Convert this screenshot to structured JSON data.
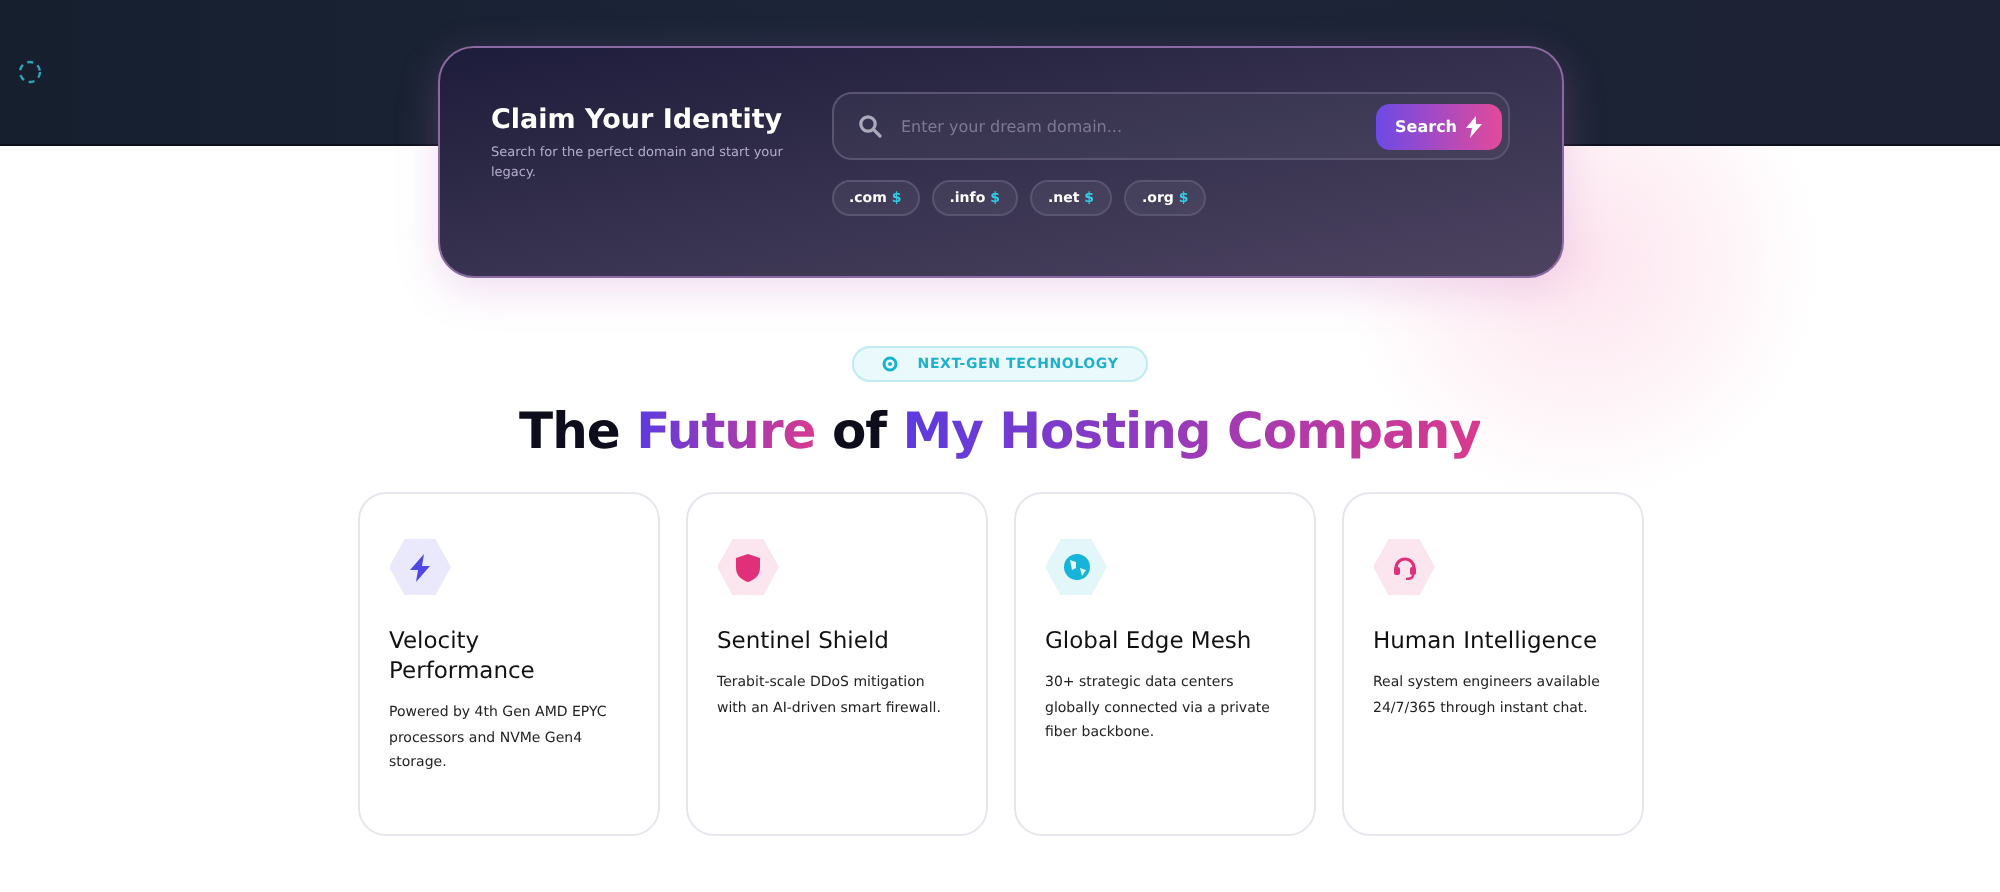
{
  "domain_search": {
    "title": "Claim Your Identity",
    "subtitle": "Search for the perfect domain and start your legacy.",
    "placeholder": "Enter your dream domain...",
    "button": "Search",
    "tlds": [
      {
        "label": ".com",
        "price": "$"
      },
      {
        "label": ".info",
        "price": "$"
      },
      {
        "label": ".net",
        "price": "$"
      },
      {
        "label": ".org",
        "price": "$"
      }
    ]
  },
  "badge": "NEXT-GEN TECHNOLOGY",
  "heading": [
    {
      "text": "The",
      "gradient": false
    },
    {
      "text": "Future",
      "gradient": true
    },
    {
      "text": "of",
      "gradient": false
    },
    {
      "text": "My Hosting Company",
      "gradient": true
    }
  ],
  "features": [
    {
      "kind": "bolt",
      "color": "#4f46e5",
      "title": "Velocity Performance",
      "text": "Powered by 4th Gen AMD EPYC processors and NVMe Gen4 storage."
    },
    {
      "kind": "shield",
      "color": "#e0307a",
      "title": "Sentinel Shield",
      "text": "Terabit-scale DDoS mitigation with an AI-driven smart firewall."
    },
    {
      "kind": "globe",
      "color": "#16b4d8",
      "title": "Global Edge Mesh",
      "text": "30+ strategic data centers globally connected via a private fiber backbone."
    },
    {
      "kind": "headset",
      "color": "#e0307a",
      "title": "Human Intelligence",
      "text": "Real system engineers available 24/7/365 through instant chat."
    }
  ]
}
